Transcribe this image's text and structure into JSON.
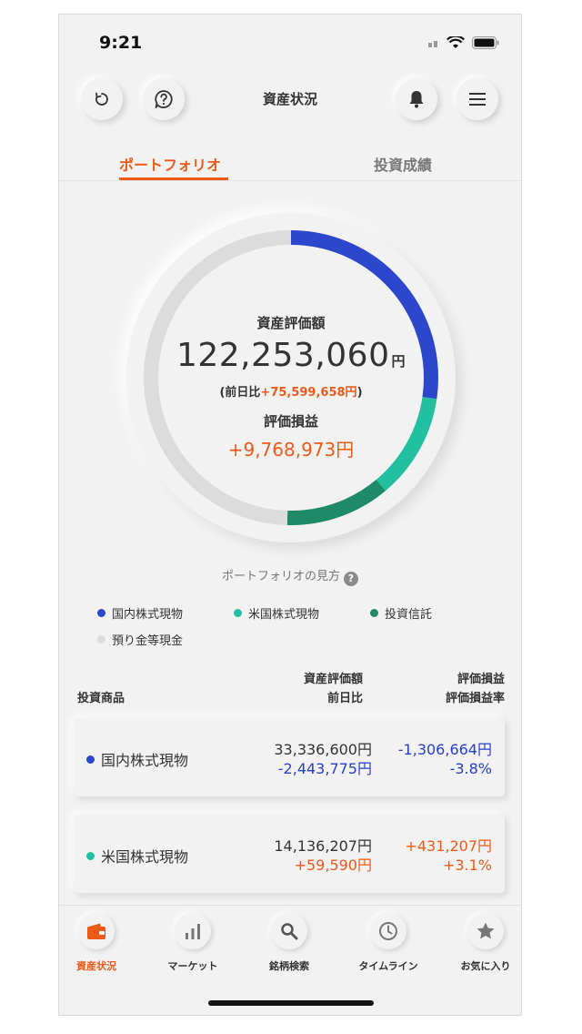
{
  "status_bar": {
    "time": "9:21"
  },
  "header": {
    "title": "資産状況"
  },
  "tabs": [
    {
      "label": "ポートフォリオ",
      "active": true
    },
    {
      "label": "投資成績",
      "active": false
    }
  ],
  "summary": {
    "valuation_label": "資産評価額",
    "valuation_value": "122,253,060",
    "valuation_unit": "円",
    "prev_day_prefix": "(前日比",
    "prev_day_value": "+75,599,658円",
    "prev_day_suffix": ")",
    "gain_label": "評価損益",
    "gain_value": "+9,768,973円"
  },
  "donut": {
    "segments": [
      {
        "name": "国内株式現物",
        "fraction": 0.273,
        "color": "#2c47cc"
      },
      {
        "name": "米国株式現物",
        "fraction": 0.116,
        "color": "#22c0a0"
      },
      {
        "name": "投資信託",
        "fraction": 0.115,
        "color": "#1f8a67"
      },
      {
        "name": "預り金等現金",
        "fraction": 0.496,
        "color": "#dcdcdc"
      }
    ]
  },
  "howto": {
    "label": "ポートフォリオの見方",
    "icon": "question-icon"
  },
  "legend": [
    {
      "label": "国内株式現物",
      "color": "#2c47cc"
    },
    {
      "label": "米国株式現物",
      "color": "#22c0a0"
    },
    {
      "label": "投資信託",
      "color": "#1f8a67"
    },
    {
      "label": "預り金等現金",
      "color": "#dcdcdc"
    }
  ],
  "table": {
    "header": {
      "product": "投資商品",
      "valuation": "資産評価額",
      "prev_day": "前日比",
      "gain": "評価損益",
      "gain_rate": "評価損益率"
    },
    "rows": [
      {
        "name": "国内株式現物",
        "color": "#2c47cc",
        "valuation": "33,336,600円",
        "prev_day": "-2,443,775円",
        "gain": "-1,306,664円",
        "gain_rate": "-3.8%"
      },
      {
        "name": "米国株式現物",
        "color": "#22c0a0",
        "valuation": "14,136,207円",
        "prev_day": "+59,590円",
        "gain": "+431,207円",
        "gain_rate": "+3.1%"
      }
    ]
  },
  "bottom_nav": [
    {
      "label": "資産状況",
      "icon": "wallet-icon",
      "active": true
    },
    {
      "label": "マーケット",
      "icon": "bar-chart-icon",
      "active": false
    },
    {
      "label": "銘柄検索",
      "icon": "search-icon",
      "active": false
    },
    {
      "label": "タイムライン",
      "icon": "clock-icon",
      "active": false
    },
    {
      "label": "お気に入り",
      "icon": "star-icon",
      "active": false
    }
  ],
  "colors": {
    "accent": "#ec5a19",
    "negative": "#2840c8"
  }
}
